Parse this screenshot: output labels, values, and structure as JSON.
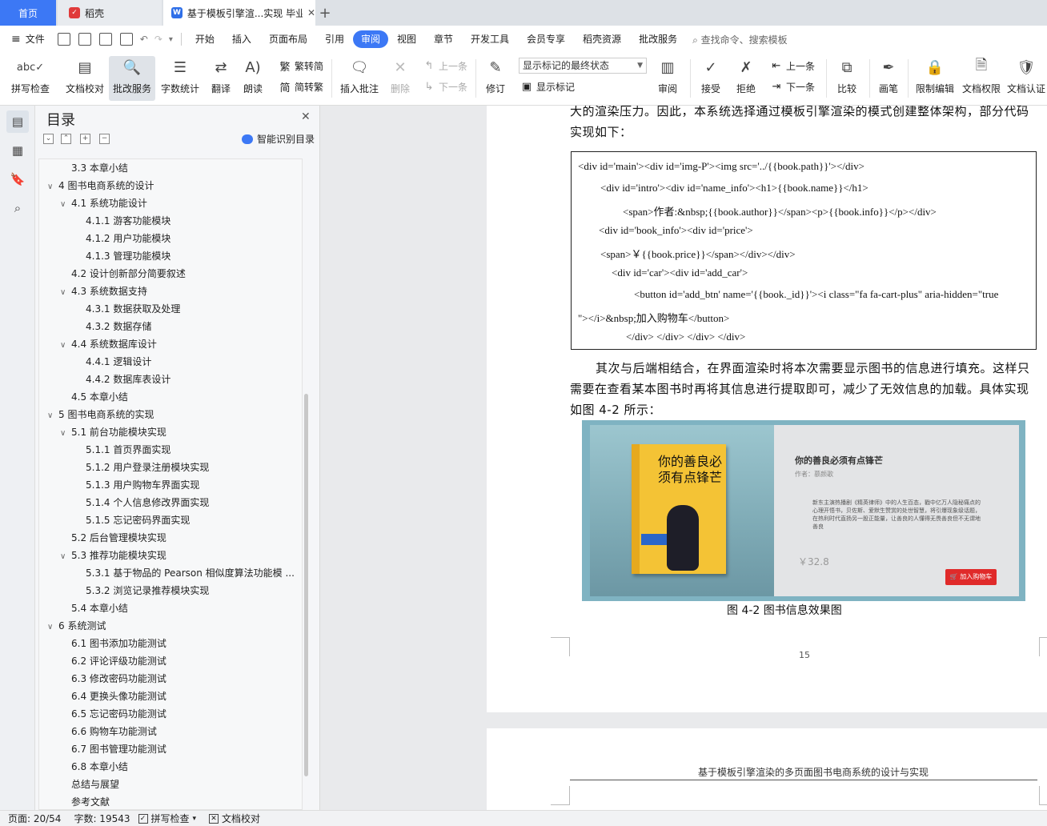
{
  "tabs": {
    "home": "首页",
    "daoke": "稻壳",
    "doc": "基于模板引擎渲...实现 毕业论文",
    "add": "+"
  },
  "menu": {
    "file": "文件",
    "items": [
      "开始",
      "插入",
      "页面布局",
      "引用",
      "审阅",
      "视图",
      "章节",
      "开发工具",
      "会员专享",
      "稻壳资源",
      "批改服务"
    ],
    "active": "审阅",
    "search": "查找命令、搜索模板"
  },
  "ribbon": {
    "spellcheck": "拼写检查",
    "doccheck": "文档校对",
    "correction": "批改服务",
    "wordcount": "字数统计",
    "translate": "翻译",
    "read": "朗读",
    "trad": "繁转简",
    "simp": "简转繁",
    "insert_comment": "插入批注",
    "delete": "删除",
    "prev": "上一条",
    "next": "下一条",
    "revise": "修订",
    "markup_state": "显示标记的最终状态",
    "show_markup": "显示标记",
    "review": "审阅",
    "accept": "接受",
    "reject": "拒绝",
    "prev2": "上一条",
    "next2": "下一条",
    "compare": "比较",
    "pen": "画笔",
    "restrict": "限制编辑",
    "doc_rights": "文档权限",
    "doc_auth": "文档认证"
  },
  "toc": {
    "title": "目录",
    "smart": "智能识别目录",
    "items": [
      {
        "level": 2,
        "text": "3.3  本章小结",
        "chev": ""
      },
      {
        "level": 1,
        "text": "4  图书电商系统的设计",
        "chev": "∨"
      },
      {
        "level": 2,
        "text": "4.1  系统功能设计",
        "chev": "∨"
      },
      {
        "level": 3,
        "text": "4.1.1  游客功能模块",
        "chev": ""
      },
      {
        "level": 3,
        "text": "4.1.2  用户功能模块",
        "chev": ""
      },
      {
        "level": 3,
        "text": "4.1.3  管理功能模块",
        "chev": ""
      },
      {
        "level": 2,
        "text": "4.2  设计创新部分简要叙述",
        "chev": ""
      },
      {
        "level": 2,
        "text": "4.3  系统数据支持",
        "chev": "∨"
      },
      {
        "level": 3,
        "text": "4.3.1  数据获取及处理",
        "chev": ""
      },
      {
        "level": 3,
        "text": "4.3.2  数据存储",
        "chev": ""
      },
      {
        "level": 2,
        "text": "4.4  系统数据库设计",
        "chev": "∨"
      },
      {
        "level": 3,
        "text": "4.4.1  逻辑设计",
        "chev": ""
      },
      {
        "level": 3,
        "text": "4.4.2  数据库表设计",
        "chev": ""
      },
      {
        "level": 2,
        "text": "4.5  本章小结",
        "chev": ""
      },
      {
        "level": 1,
        "text": "5  图书电商系统的实现",
        "chev": "∨"
      },
      {
        "level": 2,
        "text": "5.1  前台功能模块实现",
        "chev": "∨"
      },
      {
        "level": 3,
        "text": "5.1.1  首页界面实现",
        "chev": ""
      },
      {
        "level": 3,
        "text": "5.1.2  用户登录注册模块实现",
        "chev": ""
      },
      {
        "level": 3,
        "text": "5.1.3  用户购物车界面实现",
        "chev": ""
      },
      {
        "level": 3,
        "text": "5.1.4  个人信息修改界面实现",
        "chev": ""
      },
      {
        "level": 3,
        "text": "5.1.5  忘记密码界面实现",
        "chev": ""
      },
      {
        "level": 2,
        "text": "5.2  后台管理模块实现",
        "chev": ""
      },
      {
        "level": 2,
        "text": "5.3  推荐功能模块实现",
        "chev": "∨"
      },
      {
        "level": 3,
        "text": "5.3.1  基于物品的 Pearson 相似度算法功能模 ...",
        "chev": ""
      },
      {
        "level": 3,
        "text": "5.3.2  浏览记录推荐模块实现",
        "chev": ""
      },
      {
        "level": 2,
        "text": "5.4  本章小结",
        "chev": ""
      },
      {
        "level": 1,
        "text": "6  系统测试",
        "chev": "∨"
      },
      {
        "level": 2,
        "text": "6.1  图书添加功能测试",
        "chev": ""
      },
      {
        "level": 2,
        "text": "6.2  评论评级功能测试",
        "chev": ""
      },
      {
        "level": 2,
        "text": "6.3  修改密码功能测试",
        "chev": ""
      },
      {
        "level": 2,
        "text": "6.4  更换头像功能测试",
        "chev": ""
      },
      {
        "level": 2,
        "text": "6.5  忘记密码功能测试",
        "chev": ""
      },
      {
        "level": 2,
        "text": "6.6  购物车功能测试",
        "chev": ""
      },
      {
        "level": 2,
        "text": "6.7  图书管理功能测试",
        "chev": ""
      },
      {
        "level": 2,
        "text": "6.8  本章小结",
        "chev": ""
      },
      {
        "level": 0,
        "text": "总结与展望",
        "chev": ""
      },
      {
        "level": 0,
        "text": "参考文献",
        "chev": ""
      }
    ]
  },
  "doc": {
    "para1": "大的渲染压力。因此，本系统选择通过模板引擎渲染的模式创建整体架构，部分代码实现如下：",
    "code": [
      "<div id='main'><div id='img-P'><img src='../{{book.path}}'></div>",
      "<div id='intro'><div id='name_info'><h1>{{book.name}}</h1>",
      "<span>作者:&nbsp;{{book.author}}</span><p>{{book.info}}</p></div>",
      "<div id='book_info'><div id='price'>",
      "<span>￥{{book.price}}</span></div></div>",
      "<div id='car'><div id='add_car'>",
      "<button id='add_btn' name='{{book._id}}'><i class=\"fa fa-cart-plus\" aria-hidden=\"true",
      "\"></i>&nbsp;加入购物车</button>",
      "</div> </div> </div> </div>"
    ],
    "para2": "其次与后端相结合，在界面渲染时将本次需要显示图书的信息进行填充。这样只需要在查看某本图书时再将其信息进行提取即可，减少了无效信息的加载。具体实现如图 4-2 所示：",
    "figure": {
      "book_cover_title": "你的善良必须有点锋芒",
      "title": "你的善良必须有点锋芒",
      "author": "作者：慕颜歌",
      "desc": "新东主演热播剧《精英律师》中的人生百态，戳中亿万人隐秘痛点的心理开悟书，贝佐斯、爱默生赞赏的处世智慧，将引爆现象级话题，在热利时代直扬另一股正能量，让善良的人懂得无畏善良但不无谓地善良",
      "price": "￥32.8",
      "cart": "加入购物车"
    },
    "caption": "图 4-2  图书信息效果图",
    "page_number": "15",
    "header2": "基于模板引擎渲染的多页面图书电商系统的设计与实现"
  },
  "status": {
    "page": "页面: 20/54",
    "words": "字数: 19543",
    "spell": "拼写检查",
    "proof": "文档校对"
  }
}
